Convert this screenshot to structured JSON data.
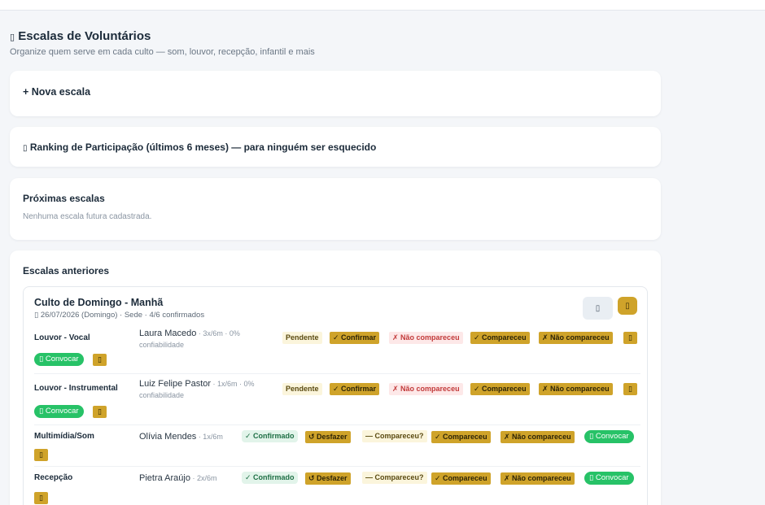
{
  "page": {
    "title": "Escalas de Voluntários",
    "title_icon": "calendar-icon",
    "subtitle": "Organize quem serve em cada culto — som, louvor, recepção, infantil e mais"
  },
  "nova_escala": {
    "label": "+ Nova escala"
  },
  "ranking": {
    "label": "Ranking de Participação (últimos 6 meses) — para ninguém ser esquecido",
    "icon": "trophy-icon"
  },
  "proximas": {
    "title": "Próximas escalas",
    "empty": "Nenhuma escala futura cadastrada."
  },
  "anteriores": {
    "title": "Escalas anteriores",
    "culto": {
      "name": "Culto de Domingo - Manhã",
      "meta": "26/07/2026 (Domingo) · Sede · 4/6 confirmados",
      "meta_icon": "calendar-icon",
      "actions": {
        "edit_icon": "edit-icon",
        "delete_icon": "trash-icon"
      },
      "rows": [
        {
          "role": "Louvor - Vocal",
          "person": "Laura Macedo",
          "stat": " · 3x/6m · 0%",
          "stat2": "confiabilidade",
          "status": "Pendente",
          "confirm": "✓ Confirmar",
          "no_show": "✗ Não compareceu",
          "showed": "✓ Compareceu",
          "no_show2": "✗ Não compareceu",
          "invite": "Convocar"
        },
        {
          "role": "Louvor - Instrumental",
          "person": "Luiz Felipe Pastor",
          "stat": " · 1x/6m · 0%",
          "stat2": "confiabilidade",
          "status": "Pendente",
          "confirm": "✓ Confirmar",
          "no_show": "✗ Não compareceu",
          "showed": "✓ Compareceu",
          "no_show2": "✗ Não compareceu",
          "invite": "Convocar"
        },
        {
          "role": "Multimídia/Som",
          "person": "Olívia Mendes",
          "stat": " · 1x/6m",
          "status": "✓ Confirmado",
          "undo": "↺ Desfazer",
          "ask": "— Compareceu?",
          "showed": "✓ Compareceu",
          "no_show": "✗ Não compareceu",
          "invite": "Convocar"
        },
        {
          "role": "Recepção",
          "person": "Pietra Araújo",
          "stat": " · 2x/6m",
          "status": "✓ Confirmado",
          "undo": "↺ Desfazer",
          "ask": "— Compareceu?",
          "showed": "✓ Compareceu",
          "no_show": "✗ Não compareceu",
          "invite": "Convocar"
        }
      ]
    }
  },
  "colors": {
    "gold": "#cfa32a",
    "green": "#27c267",
    "red": "#c23a3a"
  }
}
